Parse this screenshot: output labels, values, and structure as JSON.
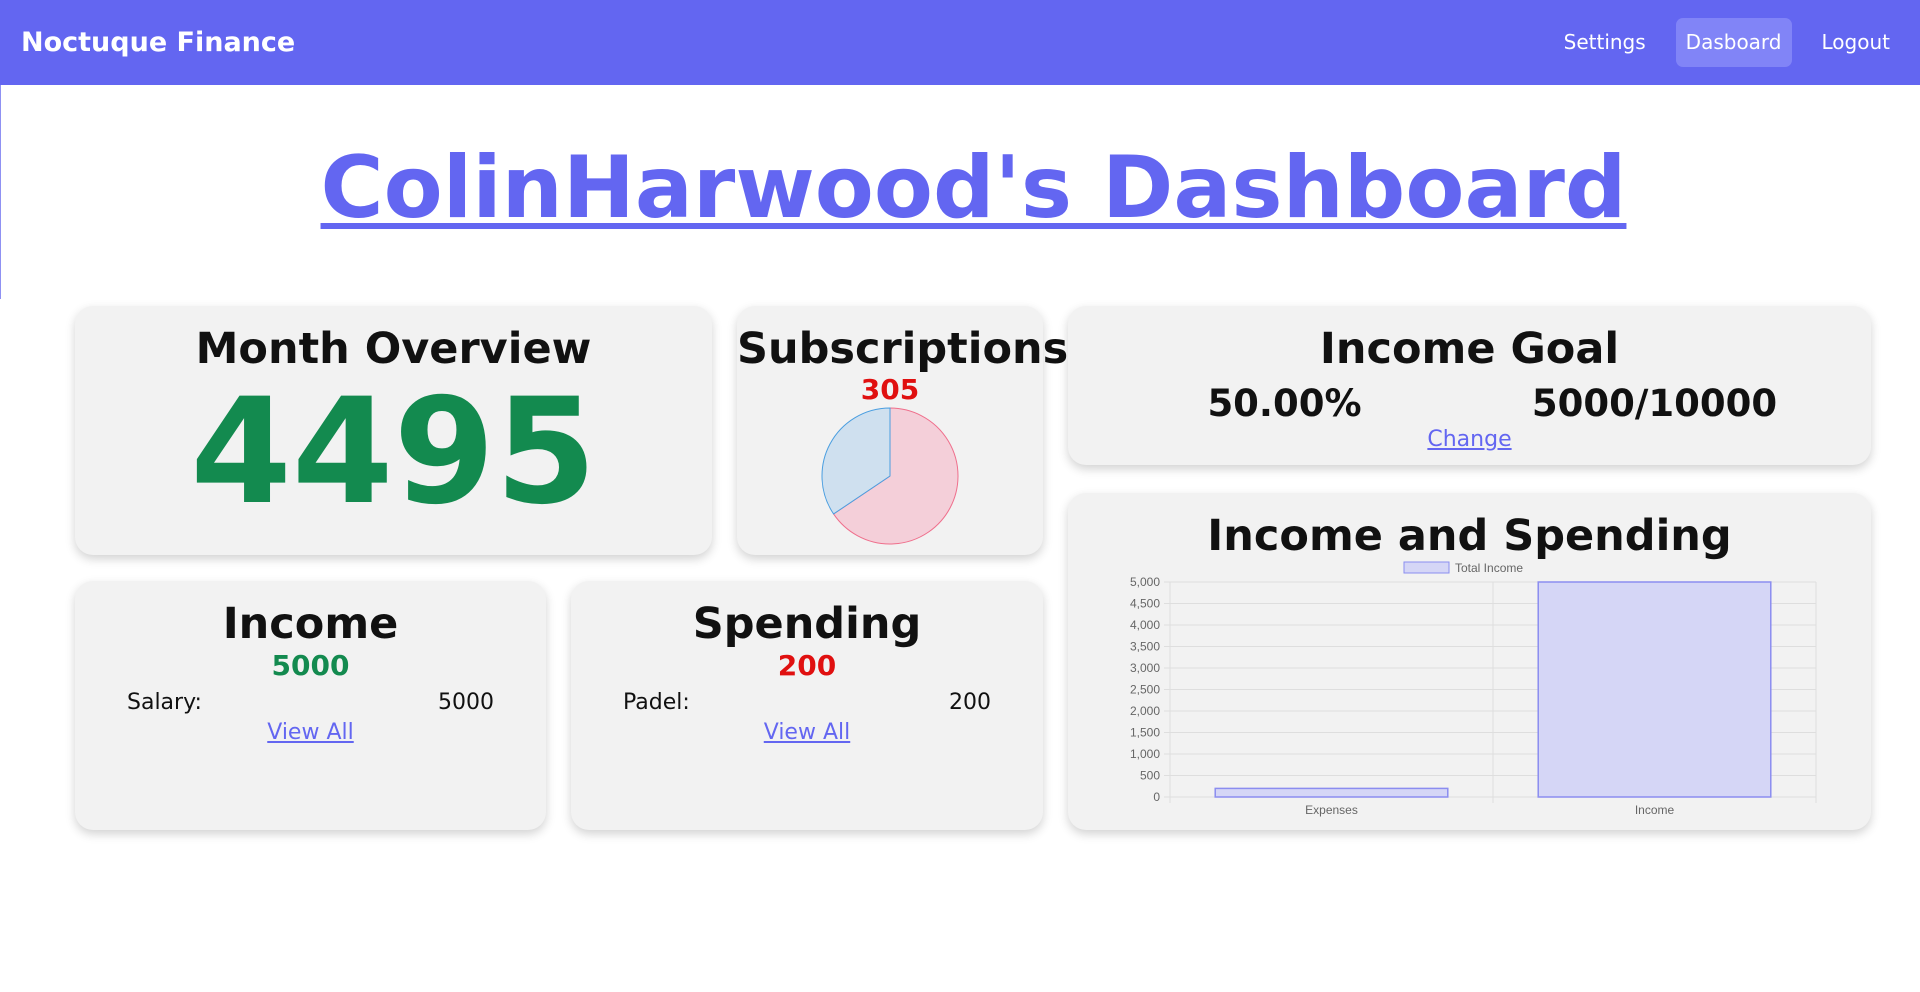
{
  "navbar": {
    "brand": "Noctuque Finance",
    "links": [
      "Settings",
      "Dasboard",
      "Logout"
    ],
    "active_link": "Dasboard",
    "color": "#6366f1"
  },
  "page_title": "ColinHarwood's Dashboard",
  "month_overview": {
    "title": "Month Overview",
    "value": "4495"
  },
  "subscriptions": {
    "title": "Subscriptions",
    "total": "305",
    "pie_slices": [
      {
        "value": 200,
        "color": "#f4cfd9",
        "stroke": "#ef6f8c"
      },
      {
        "value": 105,
        "color": "#cfe0ef",
        "stroke": "#4a9ee0"
      }
    ]
  },
  "income_goal": {
    "title": "Income Goal",
    "percent": "50.00%",
    "progress": "5000/10000",
    "change_label": "Change"
  },
  "income": {
    "title": "Income",
    "total": "5000",
    "items": [
      {
        "label": "Salary:",
        "value": "5000"
      }
    ],
    "view_all_label": "View All"
  },
  "spending": {
    "title": "Spending",
    "total": "200",
    "items": [
      {
        "label": "Padel:",
        "value": "200"
      }
    ],
    "view_all_label": "View All"
  },
  "chart_data": {
    "type": "bar",
    "title": "Income and Spending",
    "categories": [
      "Expenses",
      "Income"
    ],
    "series": [
      {
        "name": "Total Income",
        "values": [
          200,
          5000
        ]
      }
    ],
    "ylim": [
      0,
      5000
    ],
    "yticks": [
      "0",
      "500",
      "1,000",
      "1,500",
      "2,000",
      "2,500",
      "3,000",
      "3,500",
      "4,000",
      "4,500",
      "5,000"
    ],
    "grid": true,
    "legend": "top",
    "bar_color": "#d5d6f6",
    "bar_stroke": "#8b8df0"
  }
}
